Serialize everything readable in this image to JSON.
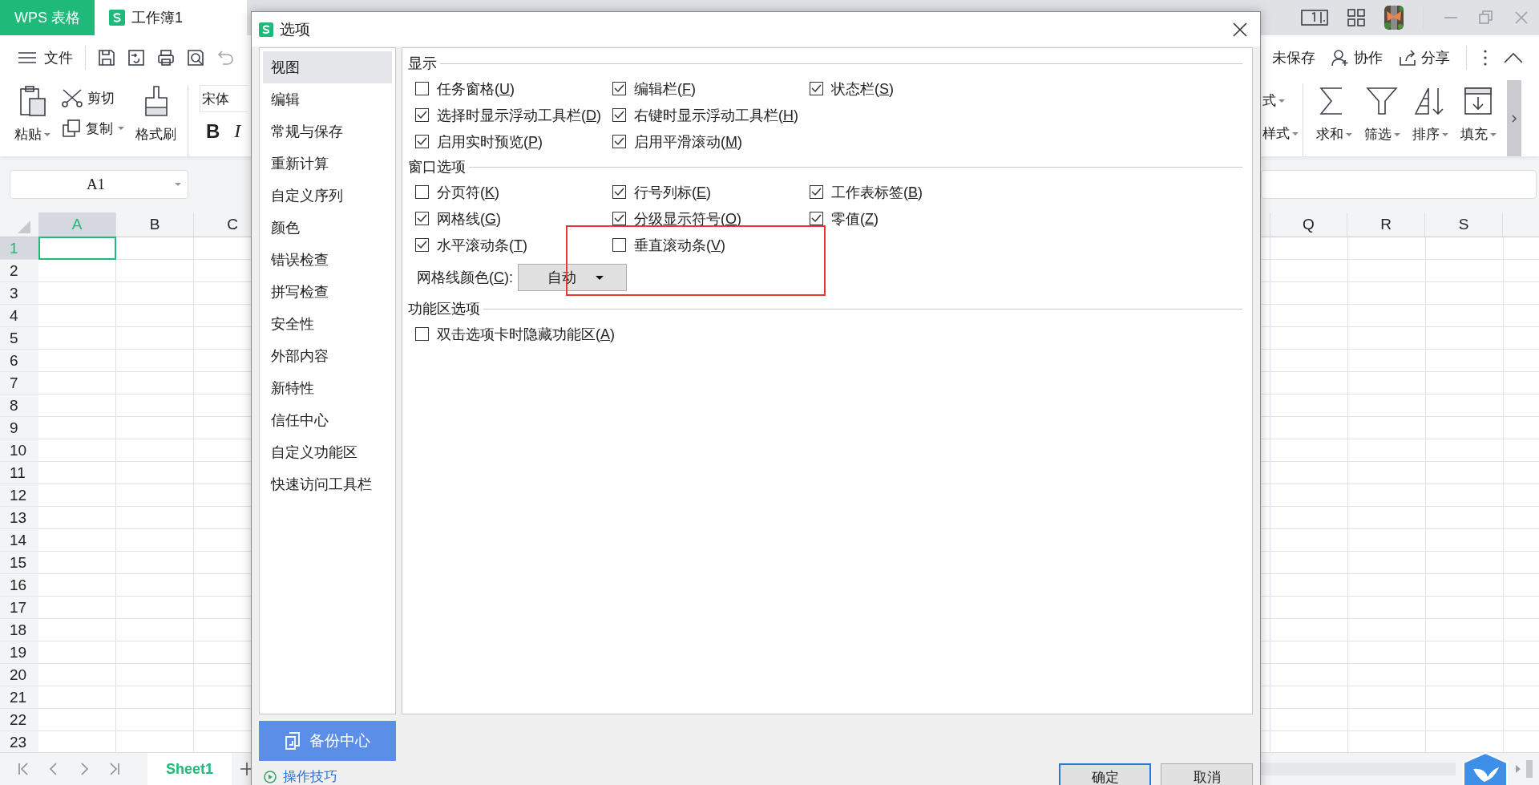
{
  "app": {
    "brand": "WPS 表格",
    "doc_tab": {
      "title": "工作簿1",
      "selected": true
    }
  },
  "menu": {
    "label": "文件"
  },
  "share_bar": [
    {
      "label": "未保存",
      "kind": "status"
    },
    {
      "label": "协作",
      "kind": "collab"
    },
    {
      "label": "分享",
      "kind": "share"
    }
  ],
  "ribbon_left": {
    "paste": "粘贴",
    "cut": "剪切",
    "copy": "复制",
    "format_painter": "格式刷",
    "font": "宋体",
    "bold": "B",
    "italic": "I"
  },
  "ribbon_right": {
    "cut_labels": [
      "式",
      "样式"
    ],
    "tools": [
      {
        "label": "求和",
        "kind": "sum"
      },
      {
        "label": "筛选",
        "kind": "filter"
      },
      {
        "label": "排序",
        "kind": "sort"
      },
      {
        "label": "填充",
        "kind": "fill"
      }
    ]
  },
  "formula_bar": {
    "name_box": "A1"
  },
  "sheet": {
    "left_columns": [
      {
        "label": "A",
        "selected": true
      },
      {
        "label": "B",
        "selected": false
      },
      {
        "label": "C",
        "selected": false
      }
    ],
    "right_columns": [
      {
        "label": "Q",
        "selected": false
      },
      {
        "label": "R",
        "selected": false
      },
      {
        "label": "S",
        "selected": false
      }
    ],
    "rows": [
      {
        "label": "1",
        "selected": true
      },
      {
        "label": "2",
        "selected": false
      },
      {
        "label": "3",
        "selected": false
      },
      {
        "label": "4",
        "selected": false
      },
      {
        "label": "5",
        "selected": false
      },
      {
        "label": "6",
        "selected": false
      },
      {
        "label": "7",
        "selected": false
      },
      {
        "label": "8",
        "selected": false
      },
      {
        "label": "9",
        "selected": false
      },
      {
        "label": "10",
        "selected": false
      },
      {
        "label": "11",
        "selected": false
      },
      {
        "label": "12",
        "selected": false
      },
      {
        "label": "13",
        "selected": false
      },
      {
        "label": "14",
        "selected": false
      },
      {
        "label": "15",
        "selected": false
      },
      {
        "label": "16",
        "selected": false
      },
      {
        "label": "17",
        "selected": false
      },
      {
        "label": "18",
        "selected": false
      },
      {
        "label": "19",
        "selected": false
      },
      {
        "label": "20",
        "selected": false
      },
      {
        "label": "21",
        "selected": false
      },
      {
        "label": "22",
        "selected": false
      },
      {
        "label": "23",
        "selected": false
      }
    ]
  },
  "sheet_tabs": [
    {
      "label": "Sheet1",
      "selected": true
    }
  ],
  "dialog": {
    "title": "选项",
    "nav": [
      {
        "label": "视图",
        "selected": true
      },
      {
        "label": "编辑",
        "selected": false
      },
      {
        "label": "常规与保存",
        "selected": false
      },
      {
        "label": "重新计算",
        "selected": false
      },
      {
        "label": "自定义序列",
        "selected": false
      },
      {
        "label": "颜色",
        "selected": false
      },
      {
        "label": "错误检查",
        "selected": false
      },
      {
        "label": "拼写检查",
        "selected": false
      },
      {
        "label": "安全性",
        "selected": false
      },
      {
        "label": "外部内容",
        "selected": false
      },
      {
        "label": "新特性",
        "selected": false
      },
      {
        "label": "信任中心",
        "selected": false
      },
      {
        "label": "自定义功能区",
        "selected": false
      },
      {
        "label": "快速访问工具栏",
        "selected": false
      }
    ],
    "sections": [
      {
        "title": "显示",
        "rows": [
          [
            {
              "kind": "checkbox",
              "label": "任务窗格(U)",
              "checked": false
            },
            {
              "kind": "checkbox",
              "label": "编辑栏(F)",
              "checked": true
            },
            {
              "kind": "checkbox",
              "label": "状态栏(S)",
              "checked": true
            }
          ],
          [
            {
              "kind": "checkbox",
              "label": "选择时显示浮动工具栏(D)",
              "checked": true
            },
            {
              "kind": "checkbox",
              "label": "右键时显示浮动工具栏(H)",
              "checked": true
            }
          ],
          [
            {
              "kind": "checkbox",
              "label": "启用实时预览(P)",
              "checked": true
            },
            {
              "kind": "checkbox",
              "label": "启用平滑滚动(M)",
              "checked": true
            }
          ]
        ]
      },
      {
        "title": "窗口选项",
        "rows": [
          [
            {
              "kind": "checkbox",
              "label": "分页符(K)",
              "checked": false
            },
            {
              "kind": "checkbox",
              "label": "行号列标(E)",
              "checked": true
            },
            {
              "kind": "checkbox",
              "label": "工作表标签(B)",
              "checked": true
            }
          ],
          [
            {
              "kind": "checkbox",
              "label": "网格线(G)",
              "checked": true
            },
            {
              "kind": "checkbox",
              "label": "分级显示符号(O)",
              "checked": true
            },
            {
              "kind": "checkbox",
              "label": "零值(Z)",
              "checked": true
            }
          ],
          [
            {
              "kind": "checkbox",
              "label": "水平滚动条(T)",
              "checked": true
            },
            {
              "kind": "checkbox",
              "label": "垂直滚动条(V)",
              "checked": false
            }
          ],
          [
            {
              "kind": "dropdown",
              "label": "网格线颜色(C):",
              "value": "自动"
            }
          ]
        ]
      },
      {
        "title": "功能区选项",
        "rows": [
          [
            {
              "kind": "checkbox",
              "label": "双击选项卡时隐藏功能区(A)",
              "checked": false
            }
          ]
        ]
      }
    ],
    "annotations": [
      {
        "kind": "rectangle"
      }
    ],
    "backup_button": "备份中心",
    "tips_link": "操作技巧",
    "buttons": [
      {
        "label": "确定",
        "kind": "primary"
      },
      {
        "label": "取消",
        "kind": "normal"
      }
    ]
  }
}
